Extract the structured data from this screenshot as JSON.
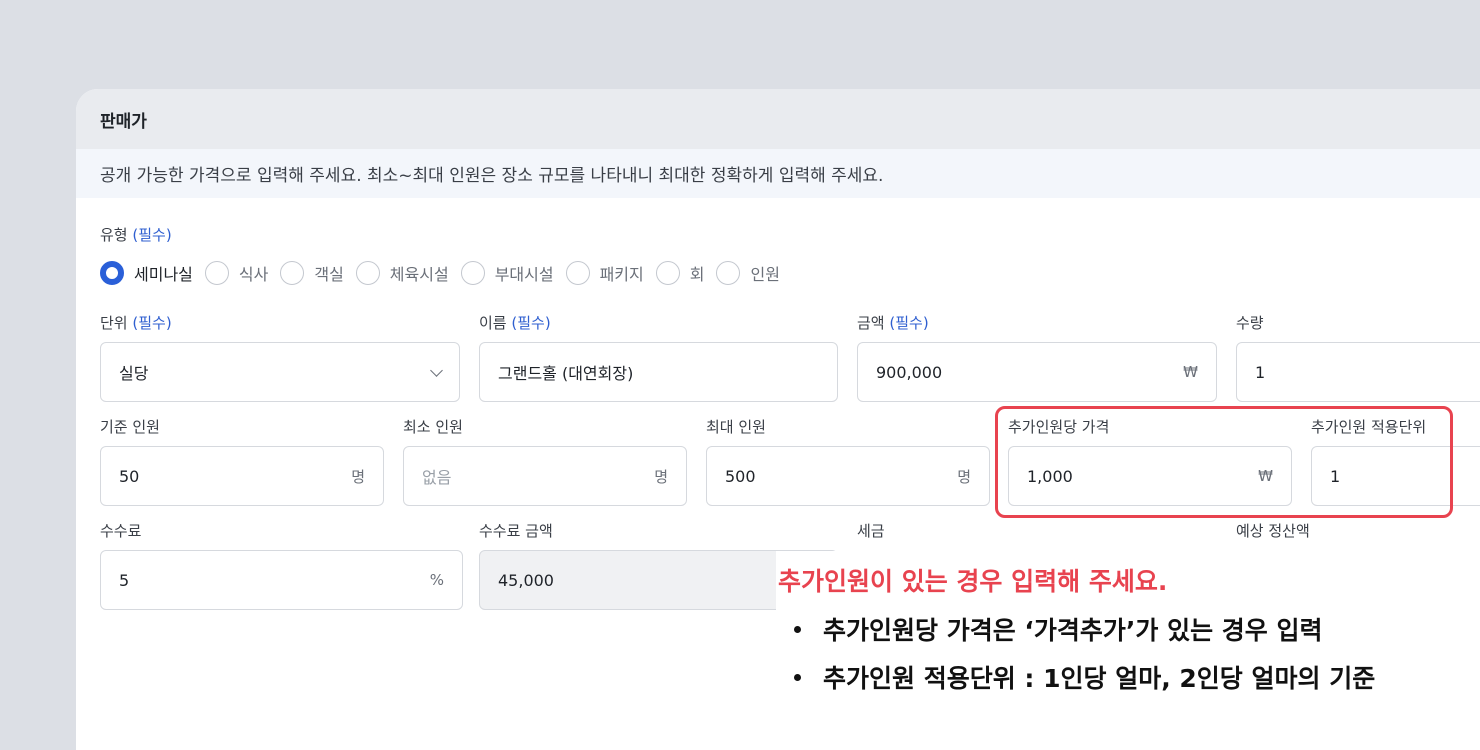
{
  "section": {
    "title": "판매가",
    "notice": "공개 가능한 가격으로 입력해 주세요. 최소~최대 인원은 장소 규모를 나타내니 최대한 정확하게 입력해 주세요."
  },
  "required_tag": "(필수)",
  "type": {
    "label": "유형",
    "options": [
      "세미나실",
      "식사",
      "객실",
      "체육시설",
      "부대시설",
      "패키지",
      "회",
      "인원"
    ],
    "selected": "세미나실"
  },
  "unit": {
    "label": "단위",
    "value": "실당"
  },
  "name": {
    "label": "이름",
    "value": "그랜드홀 (대연회장)"
  },
  "amount": {
    "label": "금액",
    "value": "900,000",
    "suffix": "₩"
  },
  "quantity": {
    "label": "수량",
    "value": "1"
  },
  "base_people": {
    "label": "기준 인원",
    "value": "50",
    "suffix": "명"
  },
  "min_people": {
    "label": "최소 인원",
    "placeholder": "없음",
    "suffix": "명"
  },
  "max_people": {
    "label": "최대 인원",
    "value": "500",
    "suffix": "명"
  },
  "extra_price": {
    "label": "추가인원당 가격",
    "value": "1,000",
    "suffix": "₩"
  },
  "extra_unit": {
    "label": "추가인원 적용단위",
    "value": "1"
  },
  "fee": {
    "label": "수수료",
    "value": "5",
    "suffix": "%"
  },
  "fee_amount": {
    "label": "수수료 금액",
    "value": "45,000"
  },
  "tax": {
    "label": "세금"
  },
  "settlement": {
    "label": "예상 정산액"
  },
  "tooltip": {
    "title": "추가인원이 있는 경우 입력해 주세요.",
    "items": [
      "추가인원당 가격은 ‘가격추가’가 있는 경우 입력",
      "추가인원 적용단위 : 1인당 얼마, 2인당 얼마의 기준"
    ]
  },
  "colors": {
    "accent": "#2a5fd8",
    "required": "#2f5fd0",
    "highlight": "#e8434f",
    "background": "#dcdfe5"
  }
}
